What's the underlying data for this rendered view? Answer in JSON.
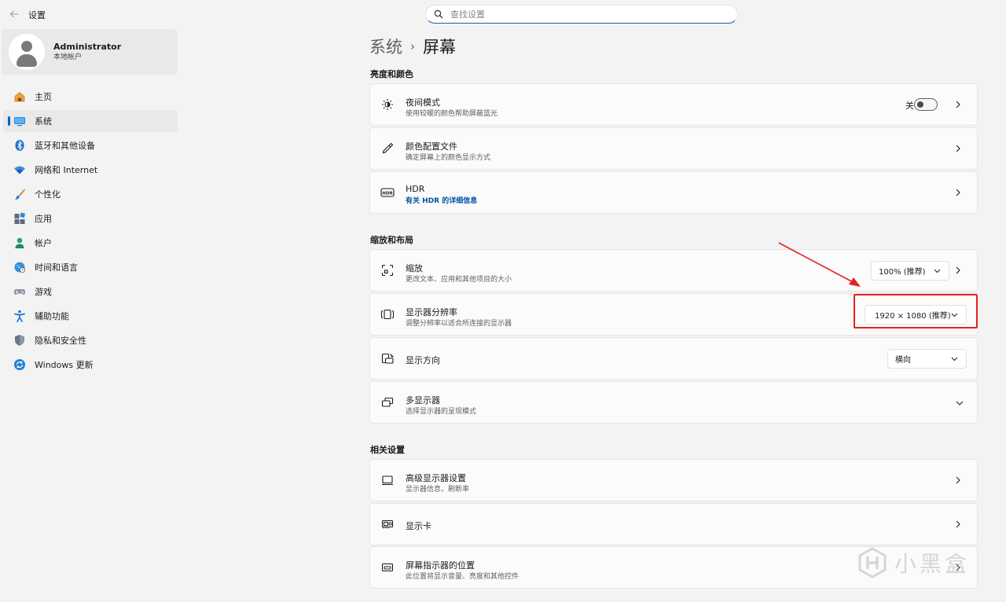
{
  "window": {
    "title": "设置"
  },
  "search": {
    "placeholder": "查找设置"
  },
  "user": {
    "name": "Administrator",
    "account_type": "本地帐户"
  },
  "nav": [
    {
      "label": "主页",
      "icon": "home-icon"
    },
    {
      "label": "系统",
      "icon": "system-icon",
      "active": true
    },
    {
      "label": "蓝牙和其他设备",
      "icon": "bluetooth-icon"
    },
    {
      "label": "网络和 Internet",
      "icon": "network-icon"
    },
    {
      "label": "个性化",
      "icon": "brush-icon"
    },
    {
      "label": "应用",
      "icon": "apps-icon"
    },
    {
      "label": "帐户",
      "icon": "account-icon"
    },
    {
      "label": "时间和语言",
      "icon": "globe-icon"
    },
    {
      "label": "游戏",
      "icon": "gamepad-icon"
    },
    {
      "label": "辅助功能",
      "icon": "accessibility-icon"
    },
    {
      "label": "隐私和安全性",
      "icon": "shield-icon"
    },
    {
      "label": "Windows 更新",
      "icon": "update-icon"
    }
  ],
  "breadcrumb": {
    "parent": "系统",
    "current": "屏幕"
  },
  "sections": {
    "brightness_color": {
      "title": "亮度和颜色",
      "night_light": {
        "title": "夜间模式",
        "subtitle": "使用较暖的颜色帮助屏蔽蓝光",
        "toggle_label": "关",
        "toggle_on": false
      },
      "color_profile": {
        "title": "颜色配置文件",
        "subtitle": "确定屏幕上的颜色显示方式"
      },
      "hdr": {
        "title": "HDR",
        "link": "有关 HDR 的详细信息"
      }
    },
    "scale_layout": {
      "title": "缩放和布局",
      "scale": {
        "title": "缩放",
        "subtitle": "更改文本、应用和其他项目的大小",
        "value": "100% (推荐)"
      },
      "resolution": {
        "title": "显示器分辨率",
        "subtitle": "调整分辨率以适合所连接的显示器",
        "value": "1920 × 1080 (推荐)"
      },
      "orientation": {
        "title": "显示方向",
        "value": "横向"
      },
      "multi_display": {
        "title": "多显示器",
        "subtitle": "选择显示器的呈现模式"
      }
    },
    "related": {
      "title": "相关设置",
      "advanced_display": {
        "title": "高级显示器设置",
        "subtitle": "显示器信息，刷新率"
      },
      "graphics": {
        "title": "显示卡"
      },
      "indicator_position": {
        "title": "屏幕指示器的位置",
        "subtitle": "此位置将显示音量、亮度和其他控件"
      }
    }
  },
  "annotation": {
    "color": "#e52121"
  },
  "watermark": {
    "text": "小黑盒"
  },
  "colors": {
    "accent": "#0067c0",
    "link": "#0053a6",
    "background": "#f3f3f3",
    "card": "#fbfbfb"
  }
}
